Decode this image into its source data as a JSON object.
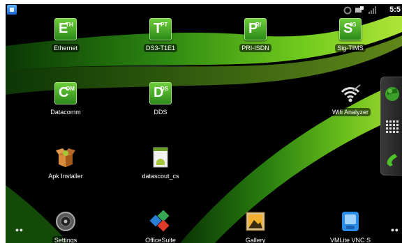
{
  "status_bar": {
    "notification_icon": "android-notification-icon",
    "icons": [
      "sync-icon",
      "screen-icon",
      "signal-bars-icon"
    ],
    "time": "5:5"
  },
  "apps": {
    "ethernet": {
      "label": "Ethernet",
      "big": "E",
      "sup": "TH"
    },
    "ds3": {
      "label": "DS3-T1E1",
      "big": "T",
      "sup": "PT"
    },
    "pri": {
      "label": "PRI-ISDN",
      "big": "P",
      "sup": "RI"
    },
    "sigtims": {
      "label": "Sig-TIMS",
      "big": "S",
      "sup": "IG"
    },
    "datacomm": {
      "label": "Datacomm",
      "big": "C",
      "sup": "OM"
    },
    "dds": {
      "label": "DDS",
      "big": "D",
      "sup": "DS"
    },
    "wifi": {
      "label": "Wifi Analyzer"
    },
    "apk": {
      "label": "Apk Installer"
    },
    "datascout": {
      "label": "datascout_cs"
    },
    "settings": {
      "label": "Settings"
    },
    "officesuite": {
      "label": "OfficeSuite"
    },
    "gallery": {
      "label": "Gallery"
    },
    "vmlite": {
      "label": "VMLite VNC S"
    }
  },
  "pager": {
    "left": "••",
    "right": "••"
  },
  "colors": {
    "accent_green": "#3faa1e",
    "dock": "#2a2a2a"
  }
}
